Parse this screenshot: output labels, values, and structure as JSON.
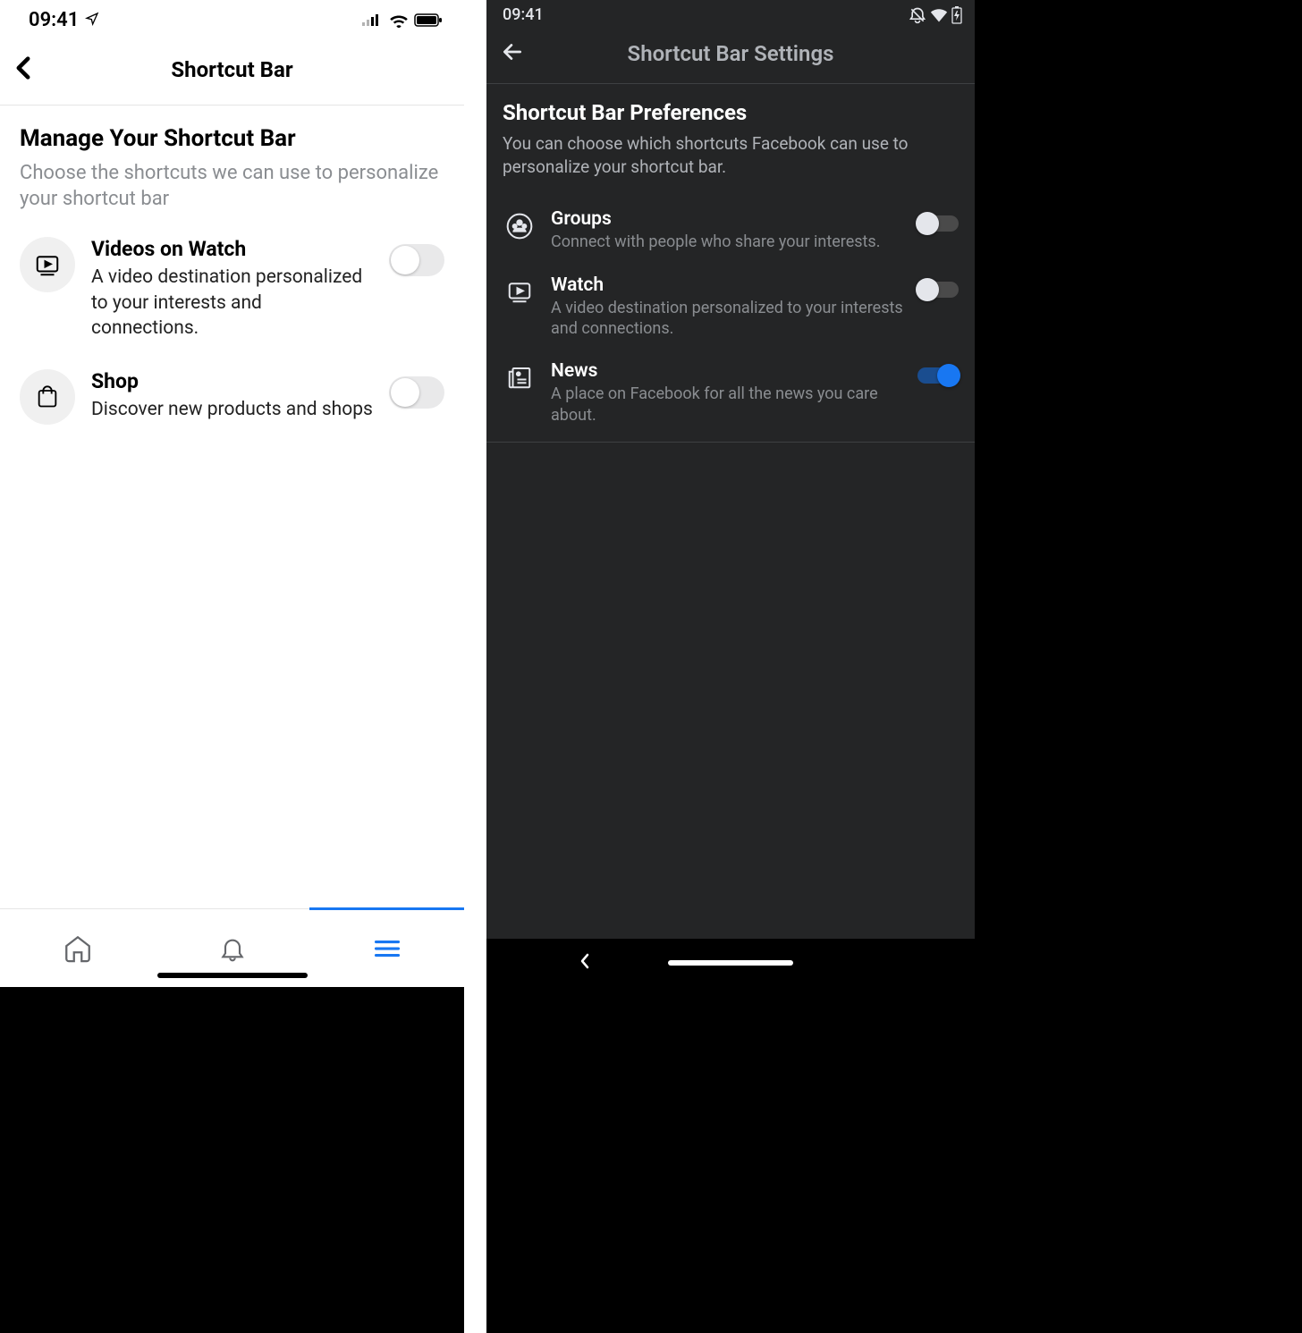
{
  "left": {
    "status": {
      "time": "09:41"
    },
    "nav": {
      "title": "Shortcut Bar"
    },
    "heading": "Manage Your Shortcut Bar",
    "subheading": "Choose the shortcuts we can use to personalize your shortcut bar",
    "items": [
      {
        "title": "Videos on Watch",
        "desc": "A video destination personalized to your interests and connections.",
        "on": false
      },
      {
        "title": "Shop",
        "desc": "Discover new products and shops",
        "on": false
      }
    ]
  },
  "right": {
    "status": {
      "time": "09:41"
    },
    "nav": {
      "title": "Shortcut Bar Settings"
    },
    "heading": "Shortcut Bar Preferences",
    "subheading": "You can choose which shortcuts Facebook can use to personalize your shortcut bar.",
    "items": [
      {
        "title": "Groups",
        "desc": "Connect with people who share your interests.",
        "on": false
      },
      {
        "title": "Watch",
        "desc": "A video destination personalized to your interests and connections.",
        "on": false
      },
      {
        "title": "News",
        "desc": "A place on Facebook for all the news you care about.",
        "on": true
      }
    ]
  }
}
